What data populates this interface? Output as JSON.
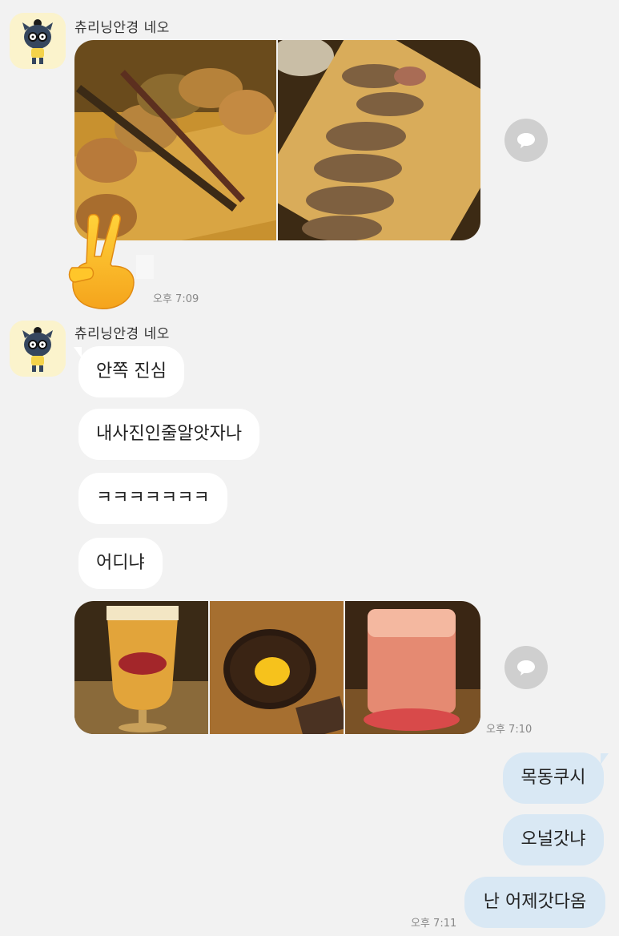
{
  "chat": {
    "msg1": {
      "sender": "츄리닝안경 네오",
      "time": "오후 7:09"
    },
    "msg2": {
      "sender": "츄리닝안경 네오",
      "bubbles": [
        "안쪽 진심",
        "내사진인줄알앗자나",
        "ㅋㅋㅋㅋㅋㅋㅋ",
        "어디냐"
      ],
      "time": "오후 7:10"
    },
    "my_messages": {
      "bubbles": [
        "목동쿠시",
        "오널갓냐",
        "난 어제갓다옴"
      ],
      "time": "오후 7:11"
    }
  },
  "icons": {
    "share": "speech-bubble-share-icon",
    "emoji": "victory-hand-emoji",
    "avatar": "neo-cat-character-avatar"
  },
  "colors": {
    "background": "#f2f2f2",
    "incoming_bubble": "#ffffff",
    "outgoing_bubble": "#d9e8f4",
    "share_button": "#cfcfcf"
  }
}
